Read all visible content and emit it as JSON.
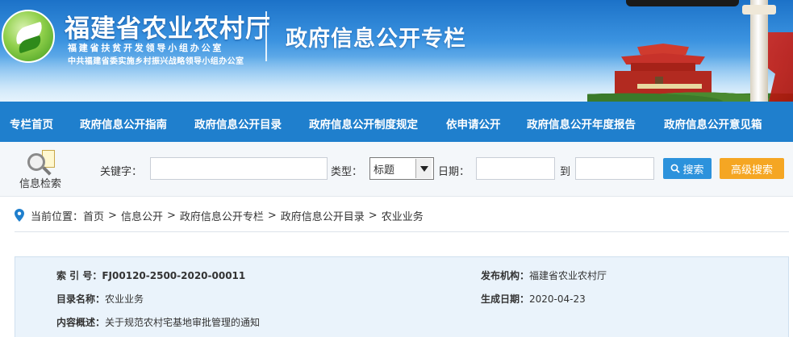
{
  "header": {
    "org_title": "福建省农业农村厅",
    "org_sub1": "福建省扶贫开发领导小组办公室",
    "org_sub2": "中共福建省委实施乡村振兴战略领导小组办公室",
    "column_title": "政府信息公开专栏"
  },
  "nav": {
    "items": [
      {
        "label": "专栏首页"
      },
      {
        "label": "政府信息公开指南"
      },
      {
        "label": "政府信息公开目录"
      },
      {
        "label": "政府信息公开制度规定"
      },
      {
        "label": "依申请公开"
      },
      {
        "label": "政府信息公开年度报告"
      },
      {
        "label": "政府信息公开意见箱"
      }
    ]
  },
  "search": {
    "icon_label": "信息检索",
    "keyword_label": "关键字：",
    "keyword_value": "",
    "type_label": "类型：",
    "type_selected": "标题",
    "date_label": "日期：",
    "date_from": "",
    "to_label": "到",
    "date_to": "",
    "search_button": "搜索",
    "advanced_button": "高级搜索"
  },
  "breadcrumb": {
    "prefix": "当前位置：",
    "items": [
      "首页",
      "信息公开",
      "政府信息公开专栏",
      "政府信息公开目录",
      "农业业务"
    ],
    "separator": ">"
  },
  "info": {
    "index_key": "索 引 号：",
    "index_value": "FJ00120-2500-2020-00011",
    "publisher_key": "发布机构：",
    "publisher_value": "福建省农业农村厅",
    "catalog_key": "目录名称：",
    "catalog_value": "农业业务",
    "date_key": "生成日期：",
    "date_value": "2020-04-23",
    "summary_key": "内容概述：",
    "summary_value": "关于规范农村宅基地审批管理的通知"
  },
  "colors": {
    "nav_bg": "#1f7fcd",
    "search_button": "#2c92dc",
    "advanced_button": "#f5a623",
    "info_bg": "#eaf3fb"
  }
}
